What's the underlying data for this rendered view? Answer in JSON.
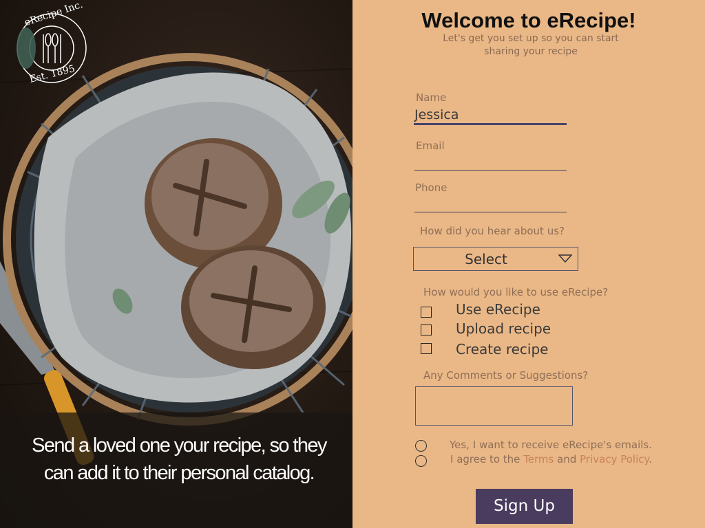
{
  "logo": {
    "brand": "eRecipe Inc.",
    "established": "Est. 1895"
  },
  "hero": {
    "tagline": "Send a loved one your recipe, so they can add it to their personal catalog."
  },
  "form": {
    "title": "Welcome to eRecipe!",
    "subtitle": "Let's get you set up so you can start sharing your recipe",
    "name": {
      "label": "Name",
      "value": "Jessica"
    },
    "email": {
      "label": "Email",
      "value": ""
    },
    "phone": {
      "label": "Phone",
      "value": ""
    },
    "hear_about": {
      "label": "How did you hear about us?",
      "selected": "Select"
    },
    "usage": {
      "label": "How would you like to use eRecipe?",
      "options": [
        {
          "label": "Use eRecipe"
        },
        {
          "label": "Upload recipe"
        },
        {
          "label": "Create recipe"
        }
      ]
    },
    "comments": {
      "label": "Any Comments or Suggestions?"
    },
    "consent": {
      "emails": "Yes, I want to receive eRecipe's emails.",
      "agree_prefix": "I agree to the ",
      "terms": "Terms",
      "and": " and ",
      "privacy": "Privacy Policy",
      "suffix": "."
    },
    "submit_label": "Sign Up"
  }
}
